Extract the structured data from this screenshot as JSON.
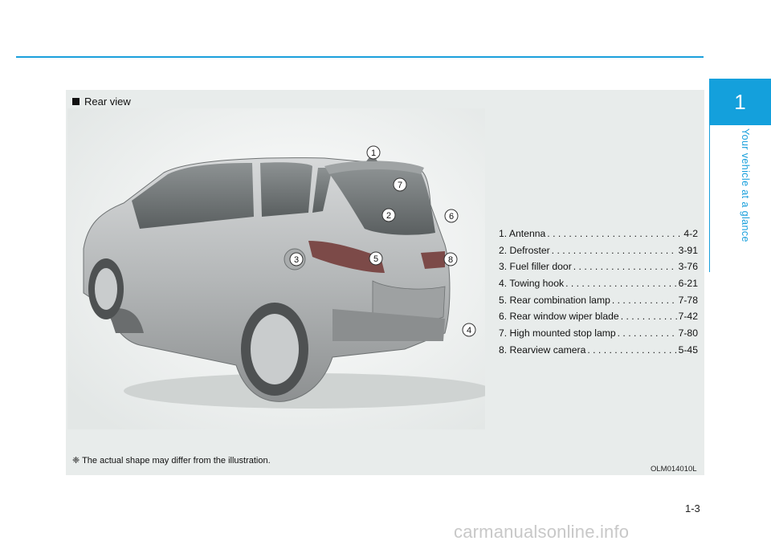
{
  "chapter": {
    "number": "1",
    "title": "Your vehicle at a glance"
  },
  "section": {
    "title": "Rear view"
  },
  "callouts": [
    "1",
    "2",
    "3",
    "4",
    "5",
    "6",
    "7",
    "8"
  ],
  "items": [
    {
      "label": "1. Antenna",
      "page": "4-2"
    },
    {
      "label": "2. Defroster",
      "page": "3-91"
    },
    {
      "label": "3. Fuel filler door",
      "page": "3-76"
    },
    {
      "label": "4. Towing hook",
      "page": "6-21"
    },
    {
      "label": "5. Rear combination lamp",
      "page": "7-78"
    },
    {
      "label": "6. Rear window wiper blade",
      "page": "7-42"
    },
    {
      "label": "7. High mounted stop lamp",
      "page": "7-80"
    },
    {
      "label": "8. Rearview camera",
      "page": "5-45"
    }
  ],
  "note": "❈ The actual shape may differ from the illustration.",
  "figure_code": "OLM014010L",
  "page_number": "1-3",
  "watermark": "carmanualsonline.info",
  "colors": {
    "accent": "#14a0dc",
    "panel": "#e8eceb",
    "car_body": "#b9bcbd"
  }
}
